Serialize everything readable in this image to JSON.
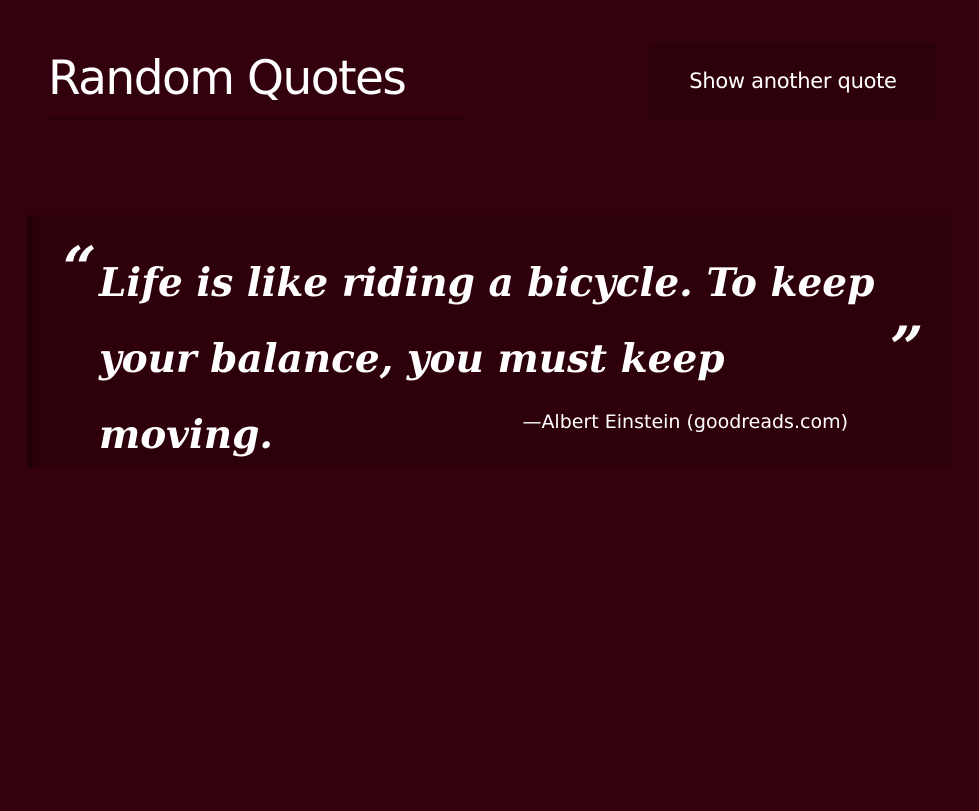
{
  "header": {
    "title": "Random Quotes",
    "button_label": "Show another quote"
  },
  "quote": {
    "open_mark": "“",
    "text": "Life is like riding a bicycle. To keep your balance, you must keep moving.",
    "close_mark": "”",
    "attribution": "—Albert Einstein (goodreads.com)"
  },
  "colors": {
    "background": "#33000d",
    "card": "#2e000b",
    "text": "#ffffff"
  }
}
